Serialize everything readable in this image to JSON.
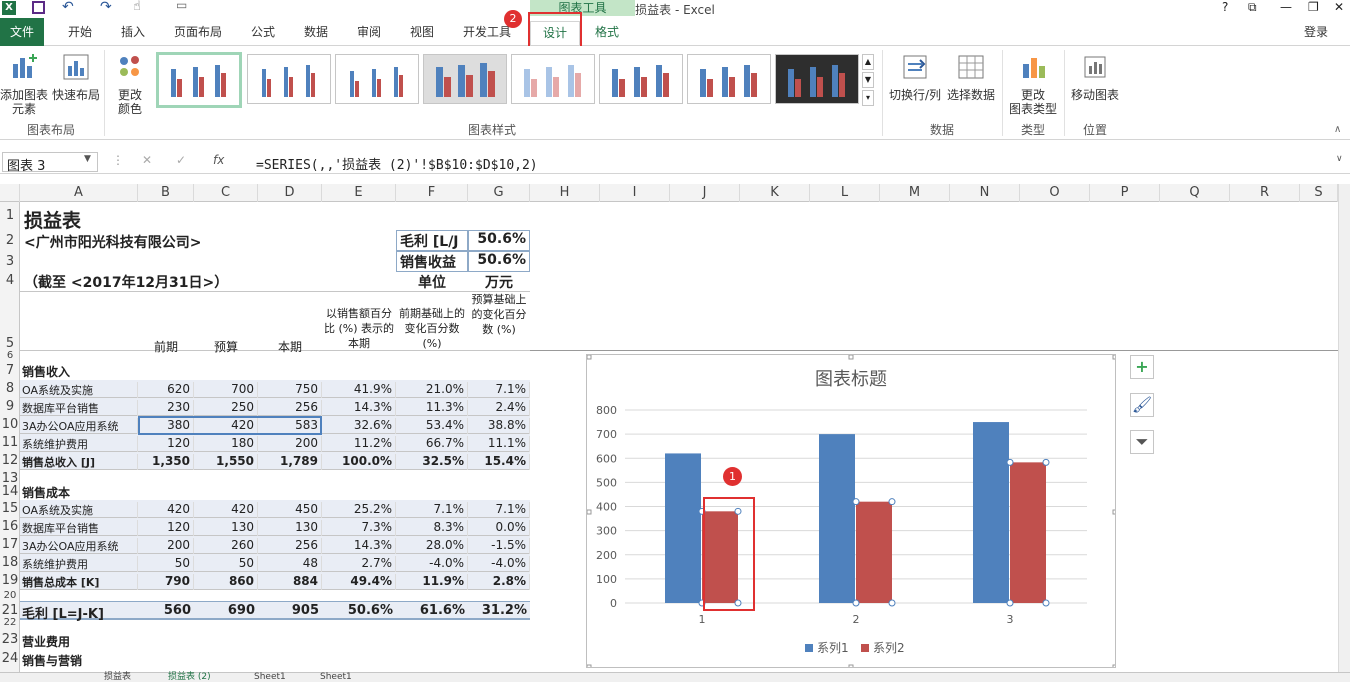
{
  "window": {
    "title": "损益表 - Excel",
    "context_group": "图表工具",
    "user": "登录",
    "help": "?"
  },
  "tabs": [
    "文件",
    "开始",
    "插入",
    "页面布局",
    "公式",
    "数据",
    "审阅",
    "视图",
    "开发工具",
    "设计",
    "格式"
  ],
  "markers": {
    "tab_badge": "2",
    "chart_badge": "1"
  },
  "ribbon": {
    "add_element": "添加图表\n元素",
    "quick_layout": "快速布局",
    "change_colors": "更改\n颜色",
    "layout_group": "图表布局",
    "styles_group": "图表样式",
    "switch_rowcol": "切换行/列",
    "select_data": "选择数据",
    "data_group": "数据",
    "change_type": "更改\n图表类型",
    "type_group": "类型",
    "move_chart": "移动图表",
    "position_group": "位置"
  },
  "formula_bar": {
    "name_box": "图表 3",
    "cancel": "✕",
    "enter": "✓",
    "fx": "fx",
    "formula": "=SERIES(,,'损益表 (2)'!$B$10:$D$10,2)"
  },
  "columns": [
    "A",
    "B",
    "C",
    "D",
    "E",
    "F",
    "G",
    "H",
    "I",
    "J",
    "K",
    "L",
    "M",
    "N",
    "O",
    "P",
    "Q",
    "R",
    "S"
  ],
  "rows": [
    "1",
    "2",
    "3",
    "4",
    "5",
    "6",
    "7",
    "8",
    "9",
    "10",
    "11",
    "12",
    "13",
    "14",
    "15",
    "16",
    "17",
    "18",
    "19",
    "20",
    "21",
    "22",
    "23",
    "24"
  ],
  "sheet": {
    "title": "损益表",
    "company": "<广州市阳光科技有限公司>",
    "date": "（截至 <2017年12月31日>）",
    "gross_label": "毛利 [L/J",
    "gross_value": "50.6%",
    "sales_label": "销售收益",
    "sales_value": "50.6%",
    "unit_label": "单位",
    "unit_value": "万元",
    "headers": [
      "前期",
      "预算",
      "本期",
      "以销售额百分比 (%) 表示的本期",
      "前期基础上的变化百分数 (%)",
      "预算基础上的变化百分数 (%)"
    ],
    "sec_revenue": "销售收入",
    "revenue_rows": [
      [
        "OA系统及实施",
        "620",
        "700",
        "750",
        "41.9%",
        "21.0%",
        "7.1%"
      ],
      [
        "数据库平台销售",
        "230",
        "250",
        "256",
        "14.3%",
        "11.3%",
        "2.4%"
      ],
      [
        "3A办公OA应用系统",
        "380",
        "420",
        "583",
        "32.6%",
        "53.4%",
        "38.8%"
      ],
      [
        "系统维护费用",
        "120",
        "180",
        "200",
        "11.2%",
        "66.7%",
        "11.1%"
      ],
      [
        "销售总收入 [J]",
        "1,350",
        "1,550",
        "1,789",
        "100.0%",
        "32.5%",
        "15.4%"
      ]
    ],
    "sec_cost": "销售成本",
    "cost_rows": [
      [
        "OA系统及实施",
        "420",
        "420",
        "450",
        "25.2%",
        "7.1%",
        "7.1%"
      ],
      [
        "数据库平台销售",
        "120",
        "130",
        "130",
        "7.3%",
        "8.3%",
        "0.0%"
      ],
      [
        "3A办公OA应用系统",
        "200",
        "260",
        "256",
        "14.3%",
        "28.0%",
        "-1.5%"
      ],
      [
        "系统维护费用",
        "50",
        "50",
        "48",
        "2.7%",
        "-4.0%",
        "-4.0%"
      ],
      [
        "销售总成本 [K]",
        "790",
        "860",
        "884",
        "49.4%",
        "11.9%",
        "2.8%"
      ]
    ],
    "gross_row": [
      "毛利 [L=J-K]",
      "560",
      "690",
      "905",
      "50.6%",
      "61.6%",
      "31.2%"
    ],
    "sec_opex": "营业费用",
    "sec_marketing": "销售与营销"
  },
  "chart_data": {
    "type": "bar",
    "title": "图表标题",
    "categories": [
      "1",
      "2",
      "3"
    ],
    "series": [
      {
        "name": "系列1",
        "values": [
          620,
          700,
          750
        ],
        "color": "#4f81bd"
      },
      {
        "name": "系列2",
        "values": [
          380,
          420,
          583
        ],
        "color": "#c0504d"
      }
    ],
    "ylim": [
      0,
      800
    ],
    "yticks": [
      "0",
      "100",
      "200",
      "300",
      "400",
      "500",
      "600",
      "700",
      "800"
    ],
    "legend": "bottom",
    "grid": true
  },
  "sheet_tabs": [
    "损益表",
    "损益表 (2)",
    "Sheet1",
    "Sheet1"
  ],
  "colors": {
    "excel_green": "#217346",
    "highlight_red": "#e03030"
  }
}
